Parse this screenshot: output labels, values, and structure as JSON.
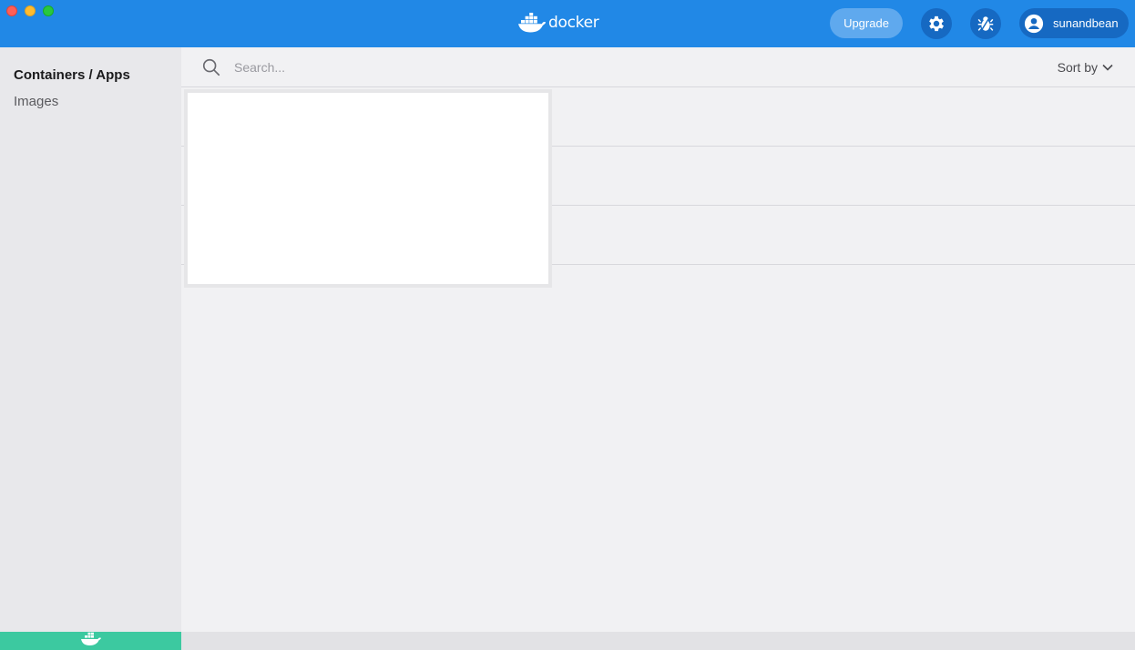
{
  "titlebar": {
    "logo_text": "docker",
    "upgrade_label": "Upgrade",
    "settings_icon": "gear-icon",
    "troubleshoot_icon": "bug-icon",
    "account_name": "sunandbean",
    "accent_color": "#2188e6"
  },
  "sidebar": {
    "items": [
      {
        "label": "Containers / Apps",
        "active": true
      },
      {
        "label": "Images",
        "active": false
      }
    ],
    "status_color": "#3cc9a0"
  },
  "main": {
    "search": {
      "placeholder": "Search...",
      "value": ""
    },
    "sort_label": "Sort by"
  }
}
